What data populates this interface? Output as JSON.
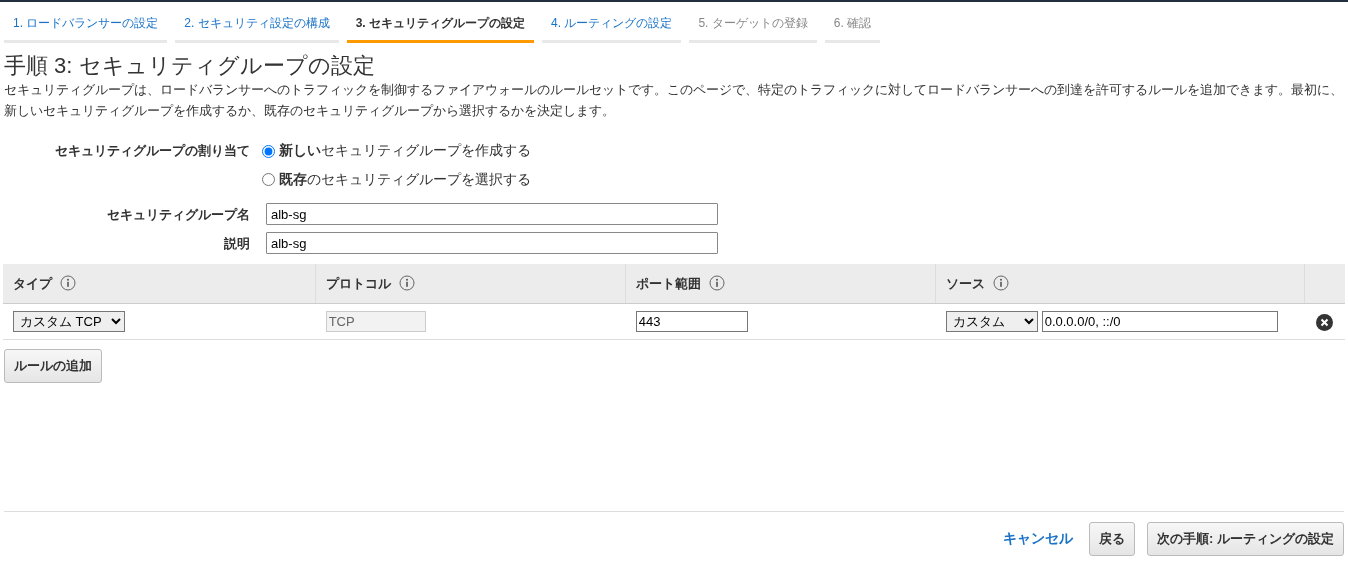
{
  "steps": [
    {
      "label": "1. ロードバランサーの設定",
      "selected": false,
      "disabled": false
    },
    {
      "label": "2. セキュリティ設定の構成",
      "selected": false,
      "disabled": false
    },
    {
      "label": "3. セキュリティグループの設定",
      "selected": true,
      "disabled": false
    },
    {
      "label": "4. ルーティングの設定",
      "selected": false,
      "disabled": false
    },
    {
      "label": "5. ターゲットの登録",
      "selected": false,
      "disabled": true
    },
    {
      "label": "6. 確認",
      "selected": false,
      "disabled": true
    }
  ],
  "title": "手順 3: セキュリティグループの設定",
  "description": "セキュリティグループは、ロードバランサーへのトラフィックを制御するファイアウォールのルールセットです。このページで、特定のトラフィックに対してロードバランサーへの到達を許可するルールを追加できます。最初に、新しいセキュリティグループを作成するか、既存のセキュリティグループから選択するかを決定します。",
  "assignment": {
    "label": "セキュリティグループの割り当て",
    "options": [
      {
        "label": "**新しい**セキュリティグループを作成する",
        "selected": true
      },
      {
        "label": "**既存**のセキュリティグループを選択する",
        "selected": false
      }
    ]
  },
  "fields": [
    {
      "label": "セキュリティグループ名",
      "value": "alb-sg"
    },
    {
      "label": "説明",
      "value": "alb-sg"
    }
  ],
  "rules_table": {
    "columns": [
      "タイプ",
      "プロトコル",
      "ポート範囲",
      "ソース"
    ],
    "rows": [
      {
        "type": "カスタム TCP",
        "protocol": "TCP",
        "port_range": "443",
        "source": "カスタム",
        "source_cidr": "0.0.0.0/0, ::/0"
      }
    ]
  },
  "add_rule_button": "ルールの追加",
  "footer": {
    "cancel": "キャンセル",
    "back": "戻る",
    "next": "次の手順: ルーティングの設定"
  }
}
